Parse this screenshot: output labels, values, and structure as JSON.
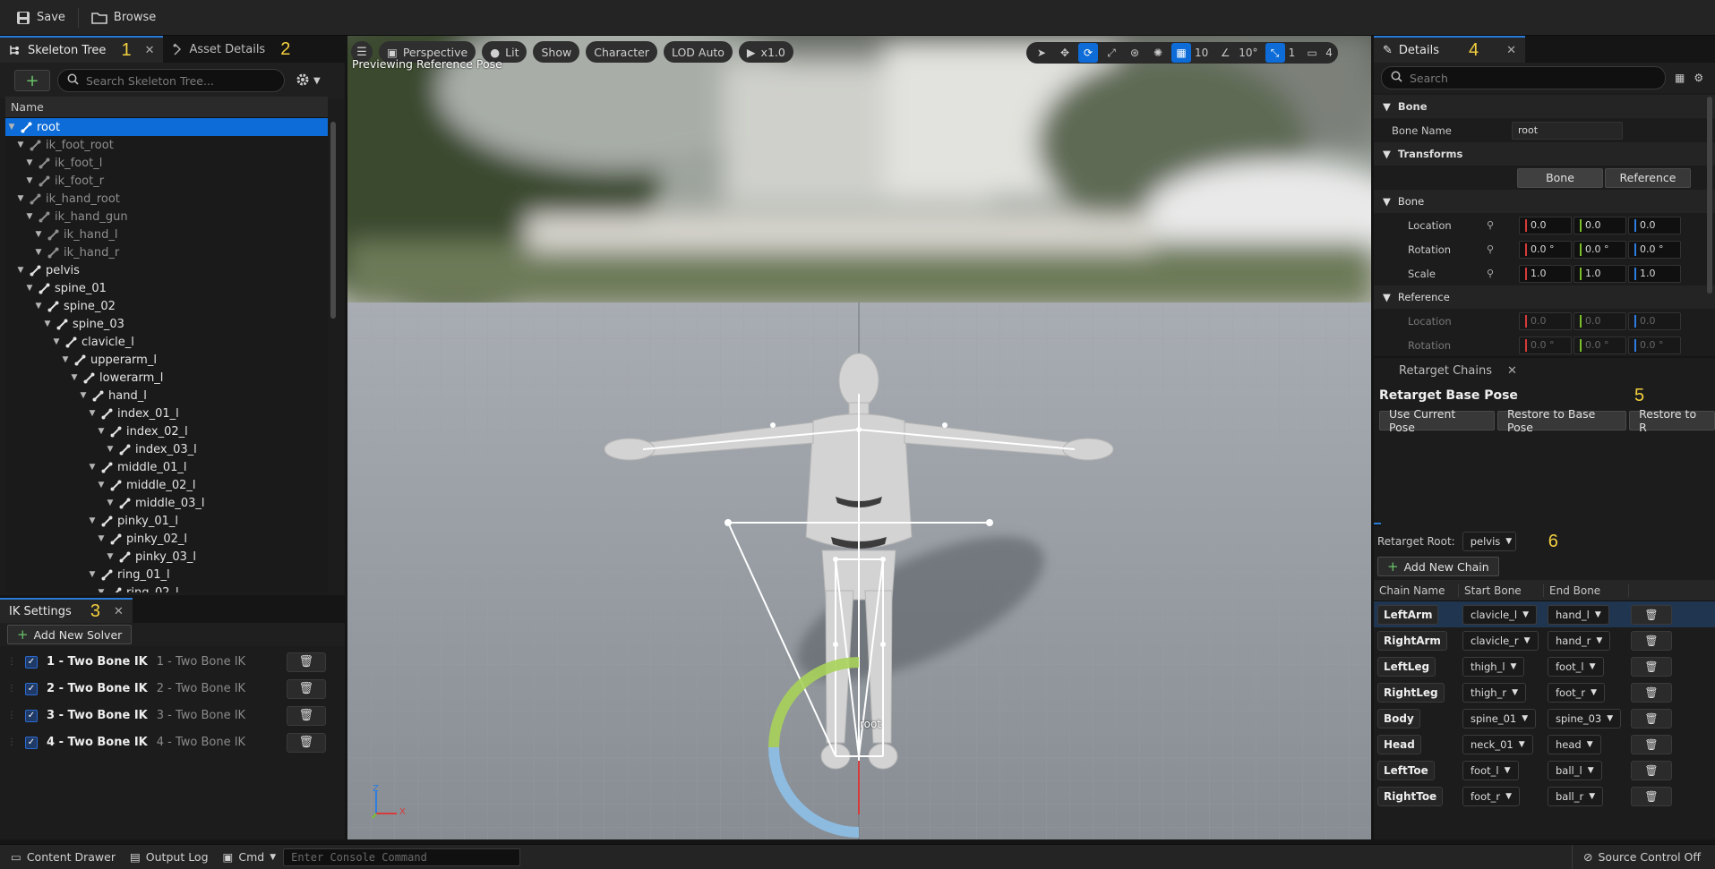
{
  "toolbar": {
    "save": "Save",
    "browse": "Browse"
  },
  "skeleton_panel": {
    "tab_label": "Skeleton Tree",
    "tab_annotation": "1",
    "tab2_label": "Asset Details",
    "tab2_annotation": "2",
    "search_placeholder": "Search Skeleton Tree...",
    "column_header": "Name",
    "bones": [
      {
        "name": "root",
        "depth": 0,
        "selected": true,
        "virtual": false
      },
      {
        "name": "ik_foot_root",
        "depth": 1,
        "virtual": true
      },
      {
        "name": "ik_foot_l",
        "depth": 2,
        "virtual": true
      },
      {
        "name": "ik_foot_r",
        "depth": 2,
        "virtual": true
      },
      {
        "name": "ik_hand_root",
        "depth": 1,
        "virtual": true
      },
      {
        "name": "ik_hand_gun",
        "depth": 2,
        "virtual": true
      },
      {
        "name": "ik_hand_l",
        "depth": 3,
        "virtual": true
      },
      {
        "name": "ik_hand_r",
        "depth": 3,
        "virtual": true
      },
      {
        "name": "pelvis",
        "depth": 1,
        "virtual": false
      },
      {
        "name": "spine_01",
        "depth": 2,
        "virtual": false
      },
      {
        "name": "spine_02",
        "depth": 3,
        "virtual": false
      },
      {
        "name": "spine_03",
        "depth": 4,
        "virtual": false
      },
      {
        "name": "clavicle_l",
        "depth": 5,
        "virtual": false
      },
      {
        "name": "upperarm_l",
        "depth": 6,
        "virtual": false
      },
      {
        "name": "lowerarm_l",
        "depth": 7,
        "virtual": false
      },
      {
        "name": "hand_l",
        "depth": 8,
        "virtual": false
      },
      {
        "name": "index_01_l",
        "depth": 9,
        "virtual": false
      },
      {
        "name": "index_02_l",
        "depth": 10,
        "virtual": false
      },
      {
        "name": "index_03_l",
        "depth": 11,
        "virtual": false
      },
      {
        "name": "middle_01_l",
        "depth": 9,
        "virtual": false
      },
      {
        "name": "middle_02_l",
        "depth": 10,
        "virtual": false
      },
      {
        "name": "middle_03_l",
        "depth": 11,
        "virtual": false
      },
      {
        "name": "pinky_01_l",
        "depth": 9,
        "virtual": false
      },
      {
        "name": "pinky_02_l",
        "depth": 10,
        "virtual": false
      },
      {
        "name": "pinky_03_l",
        "depth": 11,
        "virtual": false
      },
      {
        "name": "ring_01_l",
        "depth": 9,
        "virtual": false
      },
      {
        "name": "ring_02_l",
        "depth": 10,
        "virtual": false
      }
    ]
  },
  "ik_panel": {
    "tab_label": "IK Settings",
    "tab_annotation": "3",
    "add_solver": "Add New Solver",
    "solvers": [
      {
        "name": "1 - Two Bone IK",
        "sub": "1 - Two Bone IK"
      },
      {
        "name": "2 - Two Bone IK",
        "sub": "2 - Two Bone IK"
      },
      {
        "name": "3 - Two Bone IK",
        "sub": "3 - Two Bone IK"
      },
      {
        "name": "4 - Two Bone IK",
        "sub": "4 - Two Bone IK"
      }
    ]
  },
  "viewport": {
    "perspective": "Perspective",
    "lit": "Lit",
    "show": "Show",
    "character": "Character",
    "lod": "LOD Auto",
    "speed": "x1.0",
    "grid_snap": "10",
    "rot_snap": "10°",
    "scale_snap": "1",
    "cam_speed": "4",
    "overlay_text": "Previewing Reference Pose",
    "root_label": "root",
    "axis_z": "Z",
    "axis_x": "X"
  },
  "details": {
    "tab_label": "Details",
    "tab_annotation": "4",
    "search_placeholder": "Search",
    "section_bone": "Bone",
    "bone_name_label": "Bone Name",
    "bone_name_value": "root",
    "section_transforms": "Transforms",
    "toggle_bone": "Bone",
    "toggle_reference": "Reference",
    "subsection_bone": "Bone",
    "location_label": "Location",
    "rotation_label": "Rotation",
    "scale_label": "Scale",
    "location": [
      "0.0",
      "0.0",
      "0.0"
    ],
    "rotation": [
      "0.0 °",
      "0.0 °",
      "0.0 °"
    ],
    "scale": [
      "1.0",
      "1.0",
      "1.0"
    ],
    "subsection_reference": "Reference",
    "ref_location_label": "Location",
    "ref_rotation_label": "Rotation",
    "ref_location": [
      "0.0",
      "0.0",
      "0.0"
    ],
    "ref_rotation": [
      "0.0 °",
      "0.0 °",
      "0.0 °"
    ]
  },
  "retarget": {
    "tab_label": "Retarget Chains",
    "title": "Retarget Base Pose",
    "title_annotation": "5",
    "use_current": "Use Current Pose",
    "restore_base": "Restore to Base Pose",
    "restore_ref": "Restore to R",
    "root_label": "Retarget Root:",
    "root_value": "pelvis",
    "root_annotation": "6",
    "add_chain": "Add New Chain",
    "col_chain": "Chain Name",
    "col_start": "Start Bone",
    "col_end": "End Bone",
    "chains": [
      {
        "name": "LeftArm",
        "start": "clavicle_l",
        "end": "hand_l"
      },
      {
        "name": "RightArm",
        "start": "clavicle_r",
        "end": "hand_r"
      },
      {
        "name": "LeftLeg",
        "start": "thigh_l",
        "end": "foot_l"
      },
      {
        "name": "RightLeg",
        "start": "thigh_r",
        "end": "foot_r"
      },
      {
        "name": "Body",
        "start": "spine_01",
        "end": "spine_03"
      },
      {
        "name": "Head",
        "start": "neck_01",
        "end": "head"
      },
      {
        "name": "LeftToe",
        "start": "foot_l",
        "end": "ball_l"
      },
      {
        "name": "RightToe",
        "start": "foot_r",
        "end": "ball_r"
      }
    ]
  },
  "status": {
    "content_drawer": "Content Drawer",
    "output_log": "Output Log",
    "cmd": "Cmd",
    "console_placeholder": "Enter Console Command",
    "source_control": "Source Control Off"
  },
  "colors": {
    "accent": "#0d6cd7",
    "annotation": "#f4d03f",
    "x_axis": "#d63a3a",
    "y_axis": "#7bbf2a",
    "z_axis": "#2d7ce0"
  }
}
